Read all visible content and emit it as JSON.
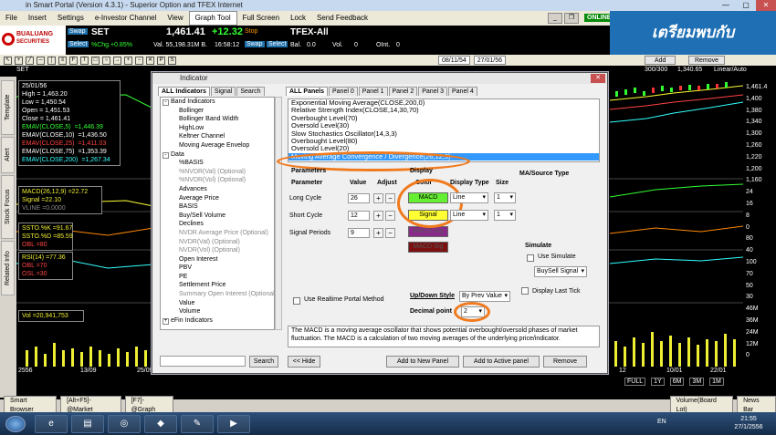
{
  "window": {
    "title": "in Smart Portal (Version 4.3.1) - Superior Option and TFEX Internet"
  },
  "menu": [
    "File",
    "Insert",
    "Settings",
    "e-Investor Channel",
    "View",
    "Graph Tool",
    "Full Screen",
    "Lock",
    "Send Feedback"
  ],
  "status_online": "ONLINE",
  "banner_text": "เตรียมพบกับ",
  "broker": {
    "name": "BUALUANG",
    "sub": "SECURITIES"
  },
  "ticker": {
    "swap1": "Swap",
    "select1": "Select",
    "symbol": "SET",
    "price": "1,461.41",
    "change": "+12.32",
    "chg_pct": "%Chg.+0.85%",
    "volume_value": "Val. 55,198.31M B.",
    "time": "16:58:12",
    "stop": "Stop",
    "swap2": "Swap",
    "select2": "Select",
    "symbol2": "TFEX-All",
    "bal": "Bal.",
    "bal_val": "0.0",
    "vol": "Vol.",
    "vol_val": "0",
    "oint": "OInt.",
    "oint_val": "0"
  },
  "toolbar": {
    "date_from": "08/11/54",
    "date_to": "27/01/56",
    "add": "Add",
    "remove": "Remove"
  },
  "setbar": {
    "symbol": "SET",
    "range": "300/300",
    "price": "1,340.65",
    "scale": "Linear/Auto"
  },
  "sidetabs": [
    "Template",
    "Alert",
    "Stock Focus",
    "Related Info"
  ],
  "price_panel": {
    "date": "25/01/56",
    "high": "High = 1,463.20",
    "low": "Low = 1,450.54",
    "open": "Open = 1,451.53",
    "close": "Close = 1,461.41",
    "emas": [
      {
        "label": "EMAV(CLOSE,5)",
        "value": "=1,446.39",
        "color": "#33ff33"
      },
      {
        "label": "EMAV(CLOSE,10)",
        "value": "=1,436.50",
        "color": "#ffffff"
      },
      {
        "label": "EMAV(CLOSE,25)",
        "value": "=1,411.03",
        "color": "#ff4040"
      },
      {
        "label": "EMAV(CLOSE,75)",
        "value": "=1,353.39",
        "color": "#ffffff"
      },
      {
        "label": "EMAV(CLOSE,200)",
        "value": "=1,267.34",
        "color": "#33ffff"
      }
    ]
  },
  "macd_panel": {
    "l1": "MACD(26,12,9)",
    "v1": "=22.72",
    "l2": "Signal",
    "v2": "=22.10",
    "l3": "VLINE",
    "v3": "=0.0000"
  },
  "ssto_panel": {
    "l1": "SSTO.%K",
    "v1": "=91.67",
    "l2": "SSTO.%D",
    "v2": "=85.59",
    "l3": "OBL",
    "v3": "=80"
  },
  "rsi_panel": {
    "l1": "RSI(14)",
    "v1": "=77.36",
    "l2": "OBL",
    "v2": "=70",
    "l3": "OSL",
    "v3": "=30"
  },
  "vol_panel": {
    "l1": "Vol",
    "v1": "=20,941,753"
  },
  "yaxis": [
    "1,461.4",
    "1,400",
    "1,380",
    "1,340",
    "1,300",
    "1,260",
    "1,220",
    "1,200",
    "1,160",
    "24",
    "16",
    "8",
    "0",
    "80",
    "40",
    "100",
    "70",
    "50",
    "30",
    "46M",
    "36M",
    "24M",
    "12M",
    "0"
  ],
  "xaxis": [
    "2556",
    "13/09",
    "25/09",
    "Oct",
    "",
    "12",
    "10/01",
    "22/01"
  ],
  "navbar": [
    "FULL",
    "1Y",
    "6M",
    "3M",
    "1M"
  ],
  "statusbar": [
    "Smart Browser",
    "[Alt+F5]-@Market",
    "[F7]-@Graph",
    "Volume(Board Lot)",
    "News Bar"
  ],
  "clock": {
    "lang": "EN",
    "time": "21:55",
    "date": "27/1/2556"
  },
  "dialog": {
    "title": "Indicator",
    "left_tabs": [
      "ALL Indicators",
      "Signal",
      "Search"
    ],
    "right_tabs": [
      "ALL Panels",
      "Panel 0",
      "Panel 1",
      "Panel 2",
      "Panel 3",
      "Panel 4"
    ],
    "tree": [
      {
        "t": "Band Indicators",
        "lvl": 0,
        "pm": "-"
      },
      {
        "t": "Bollinger",
        "lvl": 1
      },
      {
        "t": "Bollinger Band Width",
        "lvl": 1
      },
      {
        "t": "HighLow",
        "lvl": 1
      },
      {
        "t": "Keltner Channel",
        "lvl": 1
      },
      {
        "t": "Moving Average Envelop",
        "lvl": 1
      },
      {
        "t": "Data",
        "lvl": 0,
        "pm": "-"
      },
      {
        "t": "%BASIS",
        "lvl": 1
      },
      {
        "t": "%NVDR(Val) (Optional)",
        "lvl": 1,
        "g": true
      },
      {
        "t": "%NVDR(Vol) (Optional)",
        "lvl": 1,
        "g": true
      },
      {
        "t": "Advances",
        "lvl": 1
      },
      {
        "t": "Average Price",
        "lvl": 1
      },
      {
        "t": "BASIS",
        "lvl": 1
      },
      {
        "t": "Buy/Sell Volume",
        "lvl": 1
      },
      {
        "t": "Declines",
        "lvl": 1
      },
      {
        "t": "NVDR Average Price (Optional)",
        "lvl": 1,
        "g": true
      },
      {
        "t": "NVDR(Val) (Optional)",
        "lvl": 1,
        "g": true
      },
      {
        "t": "NVDR(Vol) (Optional)",
        "lvl": 1,
        "g": true
      },
      {
        "t": "Open Interest",
        "lvl": 1
      },
      {
        "t": "PBV",
        "lvl": 1
      },
      {
        "t": "PE",
        "lvl": 1
      },
      {
        "t": "Settlement Price",
        "lvl": 1
      },
      {
        "t": "Summary Open Interest (Optional)",
        "lvl": 1,
        "g": true
      },
      {
        "t": "Value",
        "lvl": 1
      },
      {
        "t": "Volume",
        "lvl": 1
      },
      {
        "t": "eFin Indicators",
        "lvl": 0,
        "pm": "+"
      }
    ],
    "search_button": "Search",
    "hide_button": "<< Hide",
    "indicators": [
      "Exponential Moving Average(CLOSE,200,0)",
      "Relative Strength Index(CLOSE,14,30,70)",
      "Overbought Level(70)",
      "Oversold Level(30)",
      "Slow Stochastics Oscillator(14,3,3)",
      "Overbought Level(80)",
      "Oversold Level(20)"
    ],
    "selected_indicator": "Moving Average Convergence / Divergence(26,12,9)",
    "headers": {
      "parameters": "Parameters",
      "display": "Display",
      "ma_source": "MA/Source Type"
    },
    "param_cols": {
      "parameter": "Parameter",
      "value": "Value",
      "adjust": "Adjust",
      "color": "Color",
      "display_type": "Display Type",
      "size": "Size"
    },
    "params": [
      {
        "name": "Long Cycle",
        "value": "26"
      },
      {
        "name": "Short Cycle",
        "value": "12"
      },
      {
        "name": "Signal Periods",
        "value": "9"
      }
    ],
    "swatches": [
      {
        "label": "MACD",
        "bg": "#66ee33"
      },
      {
        "label": "Signal",
        "bg": "#ffff33"
      },
      {
        "label": "MACD-Sig",
        "bg": "#8a2a8a"
      },
      {
        "label": "MACD-Sig",
        "bg": "#7a1010"
      }
    ],
    "display_types": [
      "Line",
      "Line"
    ],
    "sizes": [
      "1",
      "1"
    ],
    "simulate": {
      "title": "Simulate",
      "use": "Use Simulate",
      "signal": "BuySell Signal"
    },
    "use_realtime": "Use Realtime Portal Method",
    "display_last_tick": "Display Last Tick",
    "updown_label": "Up/Down Style",
    "updown_value": "By Prev Value",
    "decimal_label": "Decimal point",
    "decimal_value": "2",
    "description": "The MACD is a moving average oscillator that shows potential overbought/oversold phases of market fluctuation. The MACD is a calculation of two moving averages of the underlying price/indicator.",
    "buttons": {
      "add_new": "Add to New Panel",
      "add_active": "Add to Active panel",
      "remove": "Remove"
    }
  }
}
